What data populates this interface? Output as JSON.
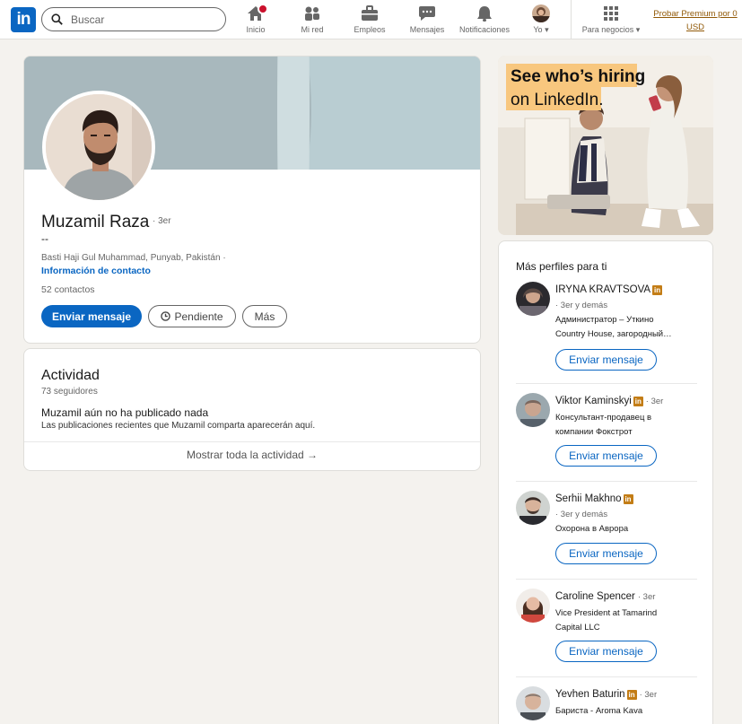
{
  "nav": {
    "search_placeholder": "Buscar",
    "items": [
      {
        "label": "Inicio",
        "icon": "home-icon"
      },
      {
        "label": "Mi red",
        "icon": "network-icon"
      },
      {
        "label": "Empleos",
        "icon": "briefcase-icon"
      },
      {
        "label": "Mensajes",
        "icon": "message-icon"
      },
      {
        "label": "Notificaciones",
        "icon": "bell-icon"
      },
      {
        "label": "Yo",
        "icon": "avatar"
      },
      {
        "label": "Para negocios",
        "icon": "grid-icon"
      }
    ],
    "premium_label": "Probar Premium por 0 USD",
    "accent": "#0a66c2",
    "badge_color": "#cb112d"
  },
  "profile": {
    "name": "Muzamil Raza",
    "degree": "· 3er",
    "headline": "--",
    "location": "Basti Haji Gul Muhammad, Punyab, Pakistán ·",
    "contact_link": "Información de contacto",
    "connections": "52 contactos",
    "btn_message": "Enviar mensaje",
    "btn_pending": "Pendiente",
    "btn_more": "Más"
  },
  "activity": {
    "title": "Actividad",
    "followers": "73 seguidores",
    "empty_title": "Muzamil aún no ha publicado nada",
    "empty_sub": "Las publicaciones recientes que Muzamil comparta aparecerán aquí.",
    "show_all": "Mostrar toda la actividad →"
  },
  "ad": {
    "headline_line1": "See who’s hiring",
    "headline_line2": "on LinkedIn."
  },
  "sidebar": {
    "title": "Más perfiles para ti",
    "people": [
      {
        "name": "IRYNA KRAVTSOVA",
        "degree": "",
        "sub": "· 3er y demás",
        "lines": [
          "Администратор – Уткино",
          "Country House, загородный…"
        ],
        "button": "Enviar mensaje"
      },
      {
        "name": "Viktor Kaminskyi",
        "degree": "· 3er",
        "sub": "",
        "lines": [
          "Консультант-продавец в",
          "компании Фокстрот"
        ],
        "button": "Enviar mensaje"
      },
      {
        "name": "Serhii Makhno",
        "degree": "",
        "sub": "· 3er y demás",
        "lines": [
          "Охорона в Аврора"
        ],
        "button": "Enviar mensaje"
      },
      {
        "name": "Caroline Spencer",
        "degree": "· 3er",
        "sub": "",
        "lines": [
          "Vice President at Tamarind",
          "Capital LLC"
        ],
        "button": "Enviar mensaje"
      },
      {
        "name": "Yevhen Baturin",
        "degree": "· 3er",
        "sub": "",
        "lines": [
          "Бариста - Aroma Kava"
        ],
        "button": ""
      }
    ]
  }
}
